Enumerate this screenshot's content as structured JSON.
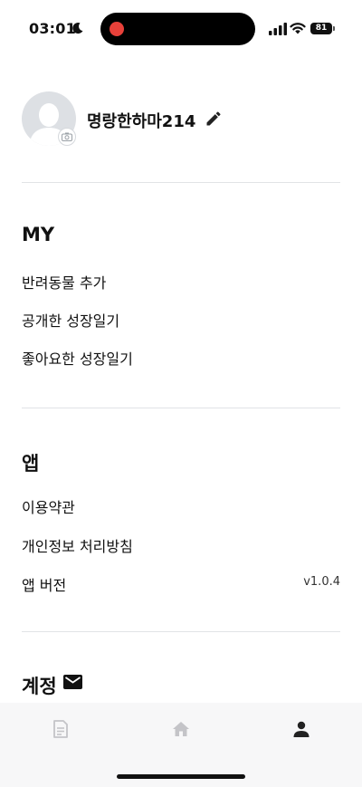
{
  "status_bar": {
    "time": "03:01",
    "battery": "81"
  },
  "profile": {
    "nickname": "명랑한하마214"
  },
  "sections": {
    "my": {
      "title": "MY",
      "items": [
        {
          "label": "반려동물 추가"
        },
        {
          "label": "공개한 성장일기"
        },
        {
          "label": "좋아요한 성장일기"
        }
      ]
    },
    "app": {
      "title": "앱",
      "items": [
        {
          "label": "이용약관"
        },
        {
          "label": "개인정보 처리방침"
        },
        {
          "label": "앱 버전",
          "value": "v1.0.4"
        }
      ]
    },
    "account": {
      "title": "계정"
    }
  },
  "tab_bar": {
    "tabs": [
      {
        "icon": "diary-icon",
        "active": false
      },
      {
        "icon": "home-icon",
        "active": false
      },
      {
        "icon": "person-icon",
        "active": true
      }
    ],
    "colors": {
      "active": "#222222",
      "inactive": "#c4c4c8"
    }
  },
  "colors": {
    "divider": "#e1e3e6",
    "recording_dot": "#e8413a"
  }
}
